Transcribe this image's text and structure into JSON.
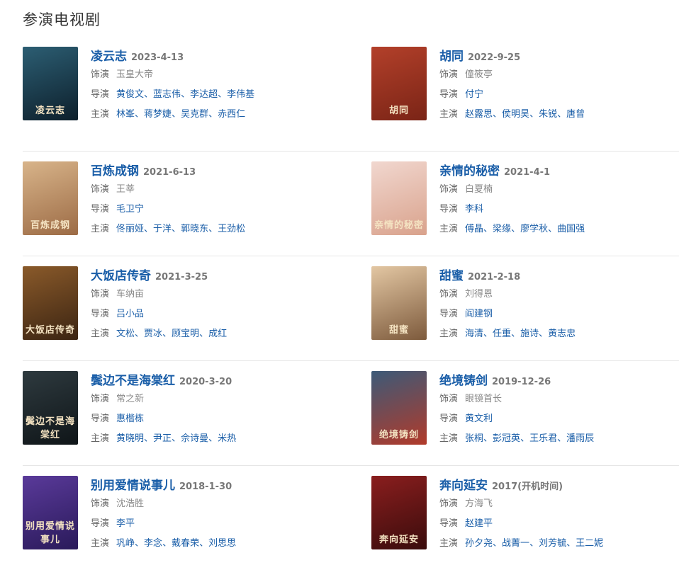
{
  "section_title": "参演电视剧",
  "labels": {
    "role": "饰演",
    "director": "导演",
    "cast": "主演"
  },
  "shows": [
    {
      "title": "凌云志",
      "date": "2023-4-13",
      "role": "玉皇大帝",
      "directors": [
        "黄俊文",
        "蓝志伟",
        "李达超",
        "李伟基"
      ],
      "cast": [
        "林峯",
        "蒋梦婕",
        "吴克群",
        "赤西仁"
      ],
      "poster_colors": [
        "#2c5e73",
        "#0d1f2b"
      ],
      "poster_caption": "凌云志"
    },
    {
      "title": "胡同",
      "date": "2022-9-25",
      "role": "僮筱亭",
      "directors": [
        "付宁"
      ],
      "cast": [
        "赵露思",
        "侯明昊",
        "朱锐",
        "唐曾"
      ],
      "poster_colors": [
        "#b3402a",
        "#7a2416"
      ],
      "poster_caption": "胡同"
    },
    {
      "title": "百炼成钢",
      "date": "2021-6-13",
      "role": "王莘",
      "directors": [
        "毛卫宁"
      ],
      "cast": [
        "佟丽娅",
        "于洋",
        "郭晓东",
        "王劲松"
      ],
      "poster_colors": [
        "#d8b48a",
        "#9c6b45"
      ],
      "poster_caption": "百炼成钢"
    },
    {
      "title": "亲情的秘密",
      "date": "2021-4-1",
      "role": "白夏楠",
      "directors": [
        "李科"
      ],
      "cast": [
        "傅晶",
        "梁缘",
        "廖学秋",
        "曲国强"
      ],
      "poster_colors": [
        "#f1d7cf",
        "#d9a28c"
      ],
      "poster_caption": "亲情的秘密"
    },
    {
      "title": "大饭店传奇",
      "date": "2021-3-25",
      "role": "车纳亩",
      "directors": [
        "吕小品"
      ],
      "cast": [
        "文松",
        "贾冰",
        "顾宝明",
        "成红"
      ],
      "poster_colors": [
        "#8a5a2a",
        "#3b2412"
      ],
      "poster_caption": "大饭店传奇"
    },
    {
      "title": "甜蜜",
      "date": "2021-2-18",
      "role": "刘得恩",
      "directors": [
        "阎建钢"
      ],
      "cast": [
        "海清",
        "任重",
        "施诗",
        "黄志忠"
      ],
      "poster_colors": [
        "#e3c7a3",
        "#7d5a3c"
      ],
      "poster_caption": "甜蜜"
    },
    {
      "title": "鬓边不是海棠红",
      "date": "2020-3-20",
      "role": "常之新",
      "directors": [
        "惠楷栋"
      ],
      "cast": [
        "黄晓明",
        "尹正",
        "佘诗曼",
        "米热"
      ],
      "poster_colors": [
        "#2e3a3f",
        "#0f1518"
      ],
      "poster_caption": "鬓边不是海棠红"
    },
    {
      "title": "绝境铸剑",
      "date": "2019-12-26",
      "role": "眼镜首长",
      "directors": [
        "黄文利"
      ],
      "cast": [
        "张桐",
        "彭冠英",
        "王乐君",
        "潘雨辰"
      ],
      "poster_colors": [
        "#3c5a78",
        "#b13a2a"
      ],
      "poster_caption": "绝境铸剑"
    },
    {
      "title": "别用爱情说事儿",
      "date": "2018-1-30",
      "role": "沈浩胜",
      "directors": [
        "李平"
      ],
      "cast": [
        "巩峥",
        "李念",
        "戴春荣",
        "刘思思"
      ],
      "poster_colors": [
        "#5a3a9a",
        "#2a1a5a"
      ],
      "poster_caption": "别用爱情说事儿"
    },
    {
      "title": "奔向延安",
      "date": "2017(开机时间)",
      "role": "方海飞",
      "directors": [
        "赵建平"
      ],
      "cast": [
        "孙夕尧",
        "战菁一",
        "刘芳毓",
        "王二妮"
      ],
      "poster_colors": [
        "#8a1e1e",
        "#3a0c0c"
      ],
      "poster_caption": "奔向延安"
    }
  ]
}
